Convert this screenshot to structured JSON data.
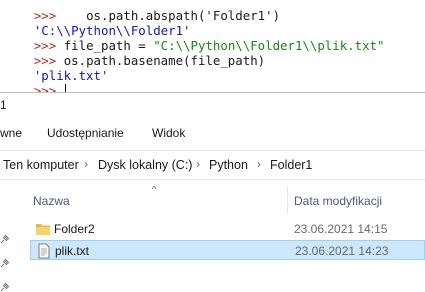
{
  "shell": {
    "line0_code": "    os.path.abspath('Folder1')",
    "line0_prompt": ">>>",
    "line1_output": "'C:\\\\Python\\\\Folder1'",
    "line2_prompt": ">>>",
    "line2_code": " file_path = ",
    "line2_string": "\"C:\\\\Python\\\\Folder1\\\\plik.txt\"",
    "line3_prompt": ">>>",
    "line3_code": " os.path.basename(file_path)",
    "line4_output": "'plik.txt'",
    "line5_prompt": ">>>"
  },
  "explorer": {
    "window_title": "1",
    "ribbon_tabs": [
      "wne",
      "Udostępnianie",
      "Widok"
    ],
    "breadcrumb": [
      "Ten komputer",
      "Dysk lokalny (C:)",
      "Python",
      "Folder1"
    ],
    "breadcrumb_separator": "›",
    "columns": {
      "name": "Nazwa",
      "date": "Data modyfikacji"
    },
    "files": [
      {
        "name": "Folder2",
        "date": "23.06.2021 14:15",
        "type": "folder",
        "selected": false
      },
      {
        "name": "plik.txt",
        "date": "23.06.2021 14:23",
        "type": "text",
        "selected": true
      }
    ]
  },
  "colors": {
    "prompt": "#b8291c",
    "string": "#168a16",
    "output": "#1414c8",
    "selection_bg": "#cce8ff",
    "selection_border": "#99d1ff",
    "folder": "#e8b94a"
  }
}
